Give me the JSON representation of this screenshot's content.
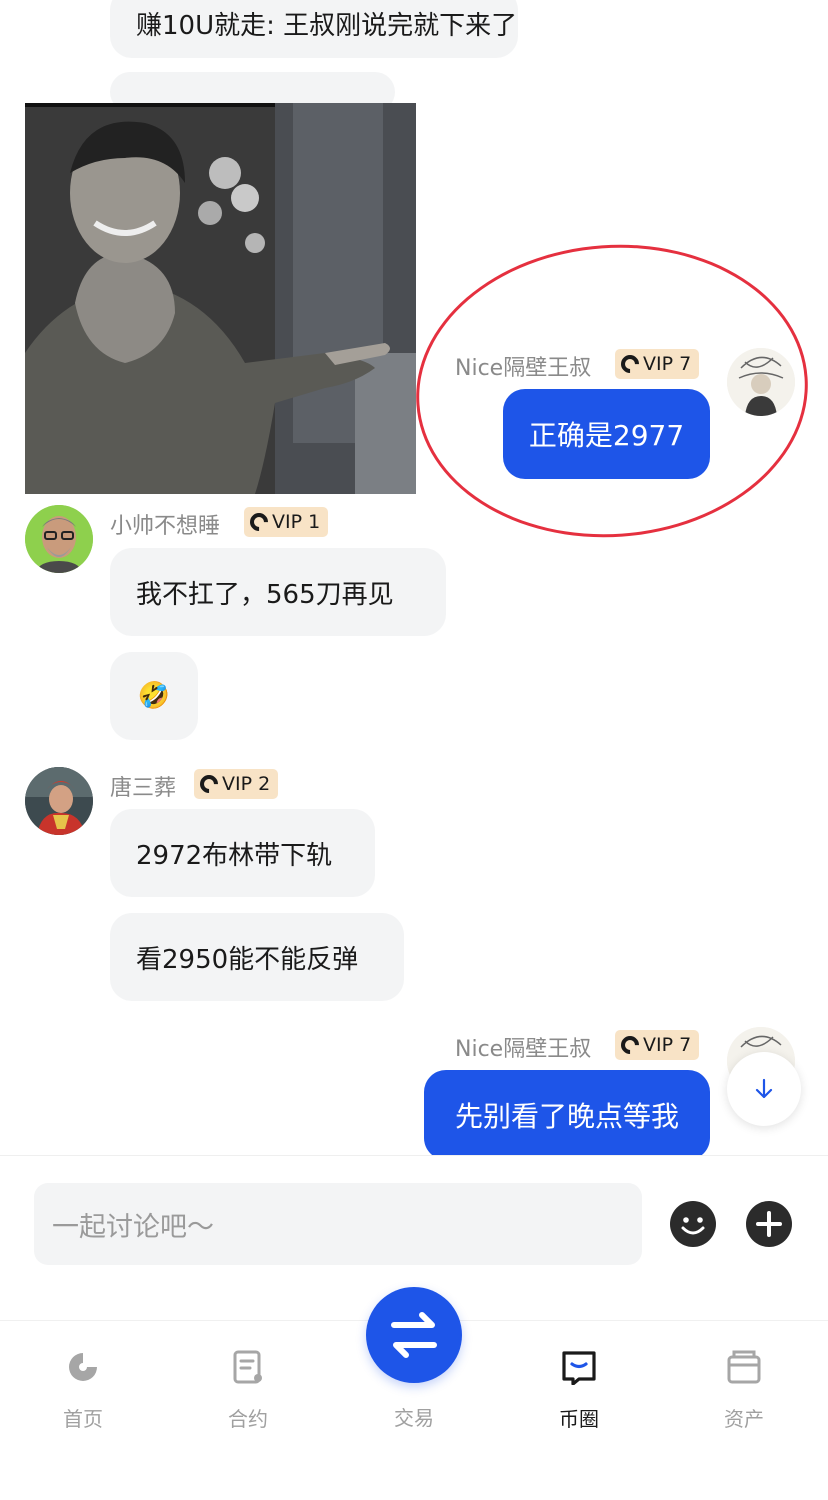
{
  "messages": {
    "m0_text": "赚10U就走: 王叔刚说完就下来了",
    "self_name": "Nice隔壁王叔",
    "self_vip": "VIP 7",
    "m1_text": "正确是2977",
    "user1_name": "小帅不想睡",
    "user1_vip": "VIP 1",
    "m2_text": "我不扛了，565刀再见",
    "m3_emoji": "🤣",
    "user2_name": "唐三葬",
    "user2_vip": "VIP 2",
    "m4_text": "2972布林带下轨",
    "m5_text": "看2950能不能反弹",
    "m6_text": "先别看了晚点等我"
  },
  "input": {
    "placeholder": "一起讨论吧～"
  },
  "tabs": [
    {
      "label": "首页",
      "icon": "home-logo-icon"
    },
    {
      "label": "合约",
      "icon": "contract-icon"
    },
    {
      "label": "交易",
      "icon": "swap-icon"
    },
    {
      "label": "币圈",
      "icon": "chat-icon"
    },
    {
      "label": "资产",
      "icon": "wallet-icon"
    }
  ],
  "active_tab": "币圈",
  "colors": {
    "accent": "#1e55e8",
    "bubble_in": "#f3f4f5",
    "vip_badge": "#f8e3c6",
    "highlight_circle": "#e5303f"
  }
}
